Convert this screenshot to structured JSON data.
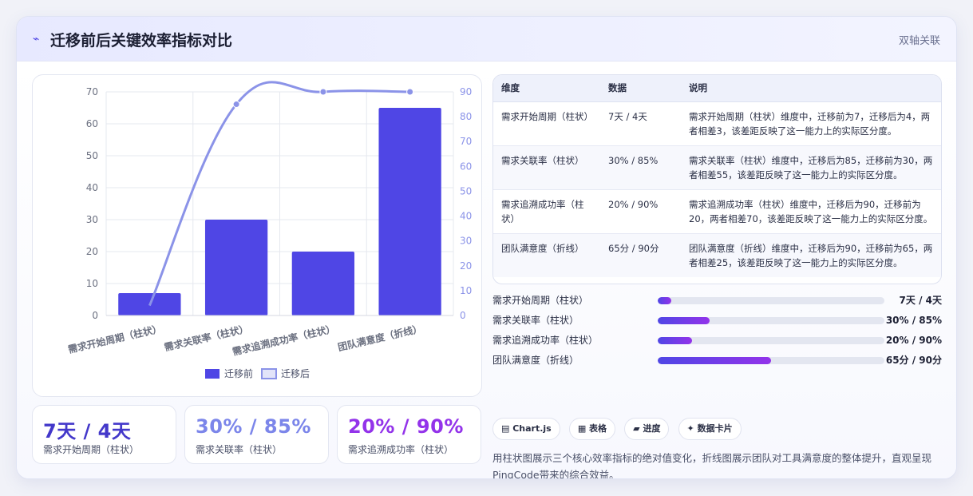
{
  "header": {
    "icon": "trend-icon",
    "title": "迁移前后关键效率指标对比",
    "tag": "双轴关联"
  },
  "colors": {
    "accent": "#4f46e5",
    "line": "#8b93e8",
    "purple": "#9333ea",
    "stat2": "#7c86ea",
    "stat3": "#9333ea"
  },
  "chart_data": {
    "type": "bar",
    "categories": [
      "需求开始周期（柱状）",
      "需求关联率（柱状）",
      "需求追溯成功率（柱状）",
      "团队满意度（折线）"
    ],
    "series": [
      {
        "name": "迁移前",
        "type": "bar",
        "axis": "left",
        "values": [
          7,
          30,
          20,
          65
        ]
      },
      {
        "name": "迁移后",
        "type": "line",
        "axis": "right",
        "values": [
          4,
          85,
          90,
          90
        ]
      }
    ],
    "ylim_left": [
      0,
      70
    ],
    "yticks_left": [
      "0",
      "10",
      "20",
      "30",
      "40",
      "50",
      "60",
      "70"
    ],
    "ylim_right": [
      0,
      90
    ],
    "yticks_right": [
      "0",
      "10",
      "20",
      "30",
      "40",
      "50",
      "60",
      "70",
      "80",
      "90"
    ],
    "grid": true,
    "legend_position": "bottom"
  },
  "stats": [
    {
      "value": "7天 / 4天",
      "label": "需求开始周期（柱状）"
    },
    {
      "value": "30% / 85%",
      "label": "需求关联率（柱状）"
    },
    {
      "value": "20% / 90%",
      "label": "需求追溯成功率（柱状）"
    }
  ],
  "table": {
    "headers": [
      "维度",
      "数据",
      "说明"
    ],
    "rows": [
      {
        "dim": "需求开始周期（柱状）",
        "data": "7天 / 4天",
        "note": "需求开始周期（柱状）维度中，迁移前为7，迁移后为4，两者相差3，该差距反映了这一能力上的实际区分度。"
      },
      {
        "dim": "需求关联率（柱状）",
        "data": "30% / 85%",
        "note": "需求关联率（柱状）维度中，迁移后为85，迁移前为30，两者相差55，该差距反映了这一能力上的实际区分度。"
      },
      {
        "dim": "需求追溯成功率（柱状）",
        "data": "20% / 90%",
        "note": "需求追溯成功率（柱状）维度中，迁移后为90，迁移前为20，两者相差70，该差距反映了这一能力上的实际区分度。"
      },
      {
        "dim": "团队满意度（折线）",
        "data": "65分 / 90分",
        "note": "团队满意度（折线）维度中，迁移后为90，迁移前为65，两者相差25，该差距反映了这一能力上的实际区分度。"
      }
    ]
  },
  "progress": [
    {
      "label": "需求开始周期（柱状）",
      "value": "7天 / 4天",
      "fraction": 0.06
    },
    {
      "label": "需求关联率（柱状）",
      "value": "30% / 85%",
      "fraction": 0.23
    },
    {
      "label": "需求追溯成功率（柱状）",
      "value": "20% / 90%",
      "fraction": 0.15
    },
    {
      "label": "团队满意度（折线）",
      "value": "65分 / 90分",
      "fraction": 0.5
    }
  ],
  "tags": [
    {
      "icon": "chart-icon",
      "label": "▤ Chart.js"
    },
    {
      "icon": "table-icon",
      "label": "▦ 表格"
    },
    {
      "icon": "progress-icon",
      "label": "▰ 进度"
    },
    {
      "icon": "card-icon",
      "label": "✦ 数据卡片"
    }
  ],
  "description": "用柱状图展示三个核心效率指标的绝对值变化，折线图展示团队对工具满意度的整体提升，直观呈现PingCode带来的综合效益。"
}
